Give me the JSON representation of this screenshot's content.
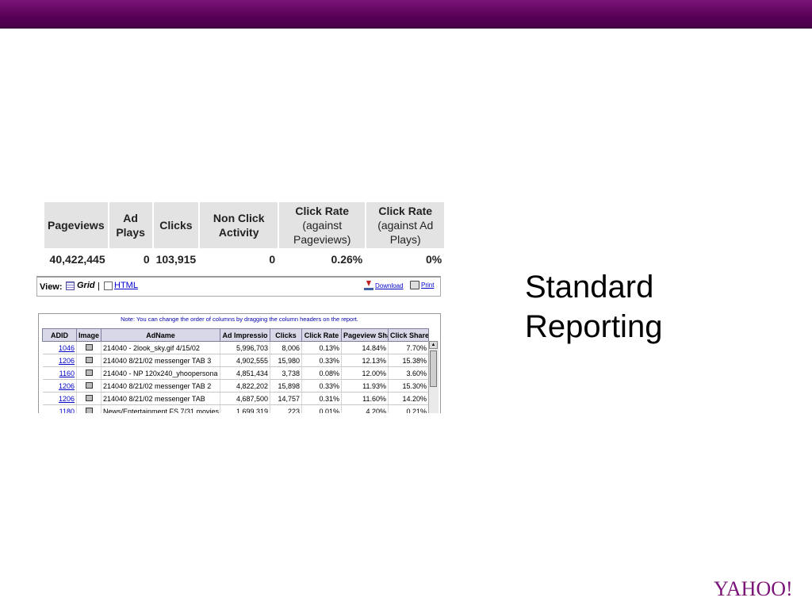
{
  "slide": {
    "heading_line1": "Standard",
    "heading_line2": "Reporting",
    "logo": "YAHOO!",
    "bar_color": "#5a0058"
  },
  "summary": {
    "headers": [
      {
        "line1": "Pageviews",
        "line2": "",
        "line3": ""
      },
      {
        "line1": "Ad",
        "line2": "Plays",
        "line3": ""
      },
      {
        "line1": "Clicks",
        "line2": "",
        "line3": ""
      },
      {
        "line1": "Non Click",
        "line2": "Activity",
        "line3": ""
      },
      {
        "line1": "Click Rate",
        "line2": "(against",
        "line3": "Pageviews)"
      },
      {
        "line1": "Click Rate",
        "line2": "(against Ad",
        "line3": "Plays)"
      }
    ],
    "values": [
      "40,422,445",
      "0",
      "103,915",
      "0",
      "0.26%",
      "0%"
    ]
  },
  "viewbar": {
    "view_label": "View:",
    "grid_label": "Grid",
    "separator": "|",
    "html_label": "HTML",
    "download_label": "Download",
    "print_label": "Print"
  },
  "report": {
    "note": "Note: You can change the order of columns by dragging the column headers on the report.",
    "columns": [
      "ADID",
      "Image",
      "AdName",
      "Ad Impressio",
      "Clicks",
      "Click Rate",
      "Pageview Sha",
      "Click Share"
    ],
    "rows": [
      [
        "1046",
        "",
        "214040 - 2look_sky.gif 4/15/02",
        "5,996,703",
        "8,006",
        "0.13%",
        "14.84%",
        "7.70%"
      ],
      [
        "1206",
        "",
        "214040 8/21/02 messenger TAB 3",
        "4,902,555",
        "15,980",
        "0.33%",
        "12.13%",
        "15.38%"
      ],
      [
        "1160",
        "",
        "214040 - NP 120x240_yhoopersona",
        "4,851,434",
        "3,738",
        "0.08%",
        "12.00%",
        "3.60%"
      ],
      [
        "1206",
        "",
        "214040 8/21/02 messenger TAB 2",
        "4,822,202",
        "15,898",
        "0.33%",
        "11.93%",
        "15.30%"
      ],
      [
        "1206",
        "",
        "214040 8/21/02 messenger TAB",
        "4,687,500",
        "14,757",
        "0.31%",
        "11.60%",
        "14.20%"
      ],
      [
        "1180",
        "",
        "News/Entertainment FS 7/31 movies",
        "1,699,319",
        "223",
        "0.01%",
        "4.20%",
        "0.21%"
      ]
    ]
  }
}
